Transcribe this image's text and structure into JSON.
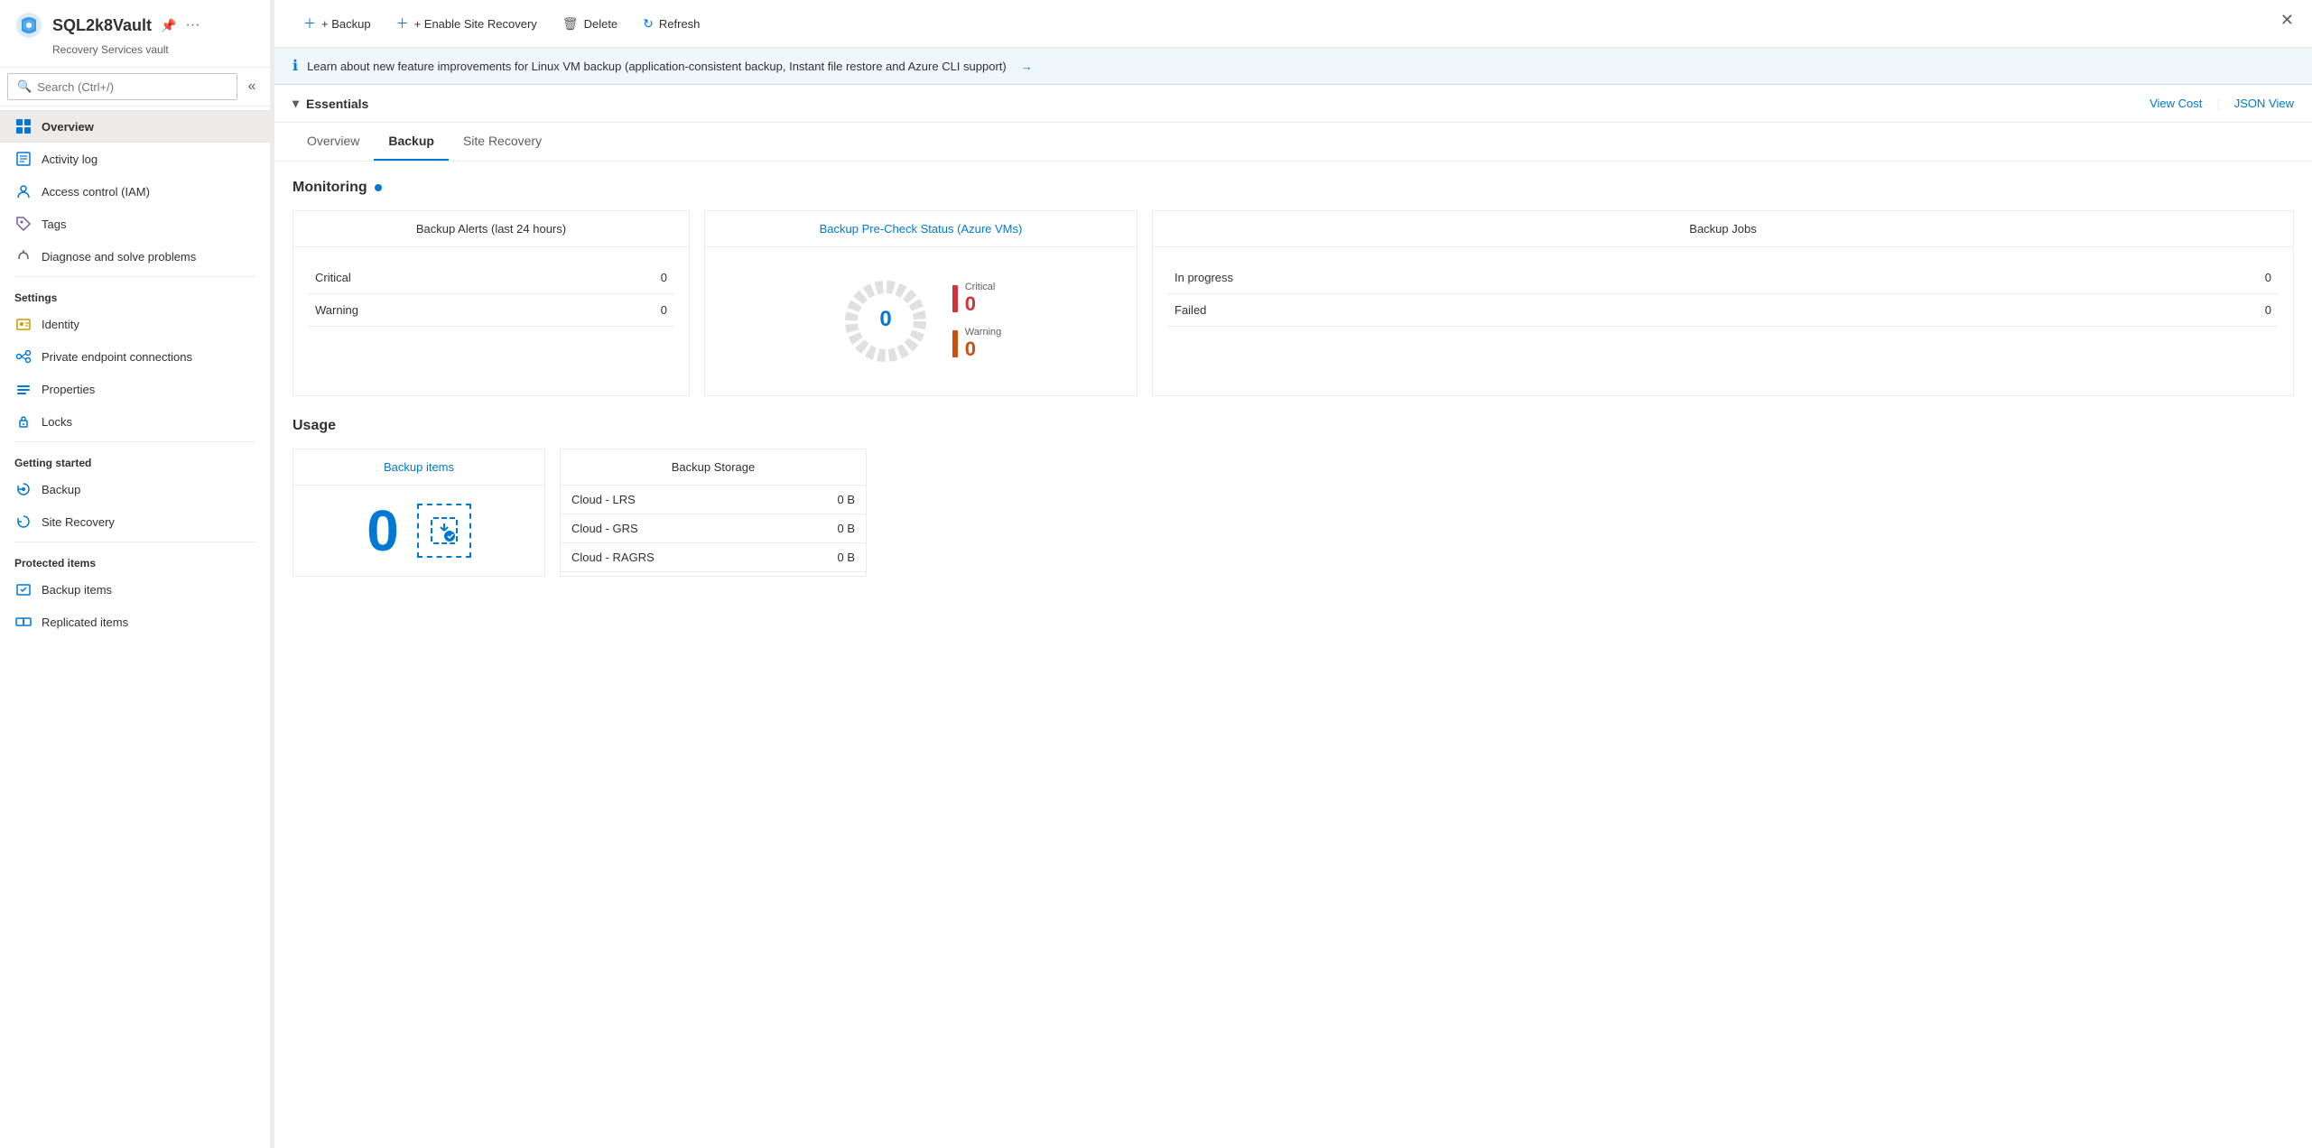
{
  "window": {
    "close_label": "✕"
  },
  "sidebar": {
    "title": "SQL2k8Vault",
    "subtitle": "Recovery Services vault",
    "search_placeholder": "Search (Ctrl+/)",
    "collapse_icon": "«",
    "nav_items": [
      {
        "id": "overview",
        "label": "Overview",
        "icon": "overview",
        "active": true,
        "section": null
      },
      {
        "id": "activity-log",
        "label": "Activity log",
        "icon": "activity",
        "active": false,
        "section": null
      },
      {
        "id": "access-control",
        "label": "Access control (IAM)",
        "icon": "iam",
        "active": false,
        "section": null
      },
      {
        "id": "tags",
        "label": "Tags",
        "icon": "tags",
        "active": false,
        "section": null
      },
      {
        "id": "diagnose",
        "label": "Diagnose and solve problems",
        "icon": "diagnose",
        "active": false,
        "section": null
      }
    ],
    "sections": {
      "settings": {
        "label": "Settings",
        "items": [
          {
            "id": "identity",
            "label": "Identity",
            "icon": "identity"
          },
          {
            "id": "private-endpoints",
            "label": "Private endpoint connections",
            "icon": "endpoints"
          },
          {
            "id": "properties",
            "label": "Properties",
            "icon": "properties"
          },
          {
            "id": "locks",
            "label": "Locks",
            "icon": "locks"
          }
        ]
      },
      "getting_started": {
        "label": "Getting started",
        "items": [
          {
            "id": "backup",
            "label": "Backup",
            "icon": "backup"
          },
          {
            "id": "site-recovery",
            "label": "Site Recovery",
            "icon": "site-recovery"
          }
        ]
      },
      "protected_items": {
        "label": "Protected items",
        "items": [
          {
            "id": "backup-items",
            "label": "Backup items",
            "icon": "backup-items"
          },
          {
            "id": "replicated-items",
            "label": "Replicated items",
            "icon": "replicated-items"
          }
        ]
      }
    }
  },
  "toolbar": {
    "backup_label": "+ Backup",
    "enable_site_recovery_label": "+ Enable Site Recovery",
    "delete_label": "Delete",
    "refresh_label": "Refresh"
  },
  "info_banner": {
    "text": "Learn about new feature improvements for Linux VM backup (application-consistent backup, Instant file restore and Azure CLI support)",
    "arrow": "→"
  },
  "essentials": {
    "label": "Essentials",
    "view_cost_label": "View Cost",
    "json_view_label": "JSON View"
  },
  "tabs": [
    {
      "id": "overview-tab",
      "label": "Overview",
      "active": false
    },
    {
      "id": "backup-tab",
      "label": "Backup",
      "active": true
    },
    {
      "id": "site-recovery-tab",
      "label": "Site Recovery",
      "active": false
    }
  ],
  "monitoring": {
    "section_title": "Monitoring",
    "backup_alerts": {
      "title": "Backup Alerts (last 24 hours)",
      "rows": [
        {
          "label": "Critical",
          "value": "0"
        },
        {
          "label": "Warning",
          "value": "0"
        }
      ]
    },
    "precheck": {
      "title": "Backup Pre-Check Status (Azure VMs)",
      "center_value": "0",
      "legend": [
        {
          "label": "Critical",
          "value": "0",
          "color": "#d13438",
          "type": "critical"
        },
        {
          "label": "Warning",
          "value": "0",
          "color": "#ca5010",
          "type": "warning"
        }
      ]
    },
    "backup_jobs": {
      "title": "Backup Jobs",
      "rows": [
        {
          "label": "In progress",
          "value": "0"
        },
        {
          "label": "Failed",
          "value": "0"
        }
      ]
    }
  },
  "usage": {
    "section_title": "Usage",
    "backup_items": {
      "title": "Backup items",
      "count": "0"
    },
    "backup_storage": {
      "title": "Backup Storage",
      "rows": [
        {
          "label": "Cloud - LRS",
          "value": "0 B"
        },
        {
          "label": "Cloud - GRS",
          "value": "0 B"
        },
        {
          "label": "Cloud - RAGRS",
          "value": "0 B"
        }
      ]
    }
  },
  "colors": {
    "accent": "#0078d4",
    "critical": "#d13438",
    "warning": "#ca5010",
    "border": "#edebe9"
  }
}
